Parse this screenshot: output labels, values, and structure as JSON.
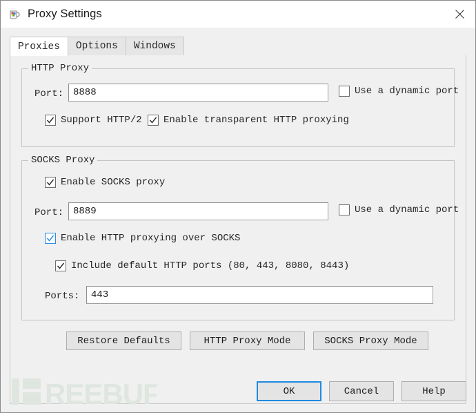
{
  "window": {
    "title": "Proxy Settings",
    "app_icon": "charles-jug-icon",
    "close_icon": "close-icon"
  },
  "tabs": [
    {
      "label": "Proxies",
      "active": true
    },
    {
      "label": "Options",
      "active": false
    },
    {
      "label": "Windows",
      "active": false
    }
  ],
  "http_proxy": {
    "group_title": "HTTP Proxy",
    "port_label": "Port:",
    "port_value": "8888",
    "dynamic_port": {
      "label": "Use a dynamic port",
      "checked": false
    },
    "support_http2": {
      "label": "Support HTTP/2",
      "checked": true
    },
    "transparent": {
      "label": "Enable transparent HTTP proxying",
      "checked": true
    }
  },
  "socks_proxy": {
    "group_title": "SOCKS Proxy",
    "enable": {
      "label": "Enable SOCKS proxy",
      "checked": true
    },
    "port_label": "Port:",
    "port_value": "8889",
    "dynamic_port": {
      "label": "Use a dynamic port",
      "checked": false
    },
    "http_over_socks": {
      "label": "Enable HTTP proxying over SOCKS",
      "checked": true,
      "focused": true
    },
    "include_default": {
      "label": "Include default HTTP ports (80, 443, 8080, 8443)",
      "checked": true
    },
    "ports_label": "Ports:",
    "ports_value": "443"
  },
  "mode_buttons": {
    "restore_defaults": "Restore Defaults",
    "http_proxy_mode": "HTTP Proxy Mode",
    "socks_proxy_mode": "SOCKS Proxy Mode"
  },
  "dialog_buttons": {
    "ok": "OK",
    "cancel": "Cancel",
    "help": "Help"
  },
  "watermark": {
    "text": "REEBUF",
    "color": "#dfe6e0"
  },
  "colors": {
    "accent_blue": "#1e8ae0",
    "dialog_bg": "#f0f0f0",
    "field_bg": "#ffffff",
    "border": "#c4c4c4"
  }
}
